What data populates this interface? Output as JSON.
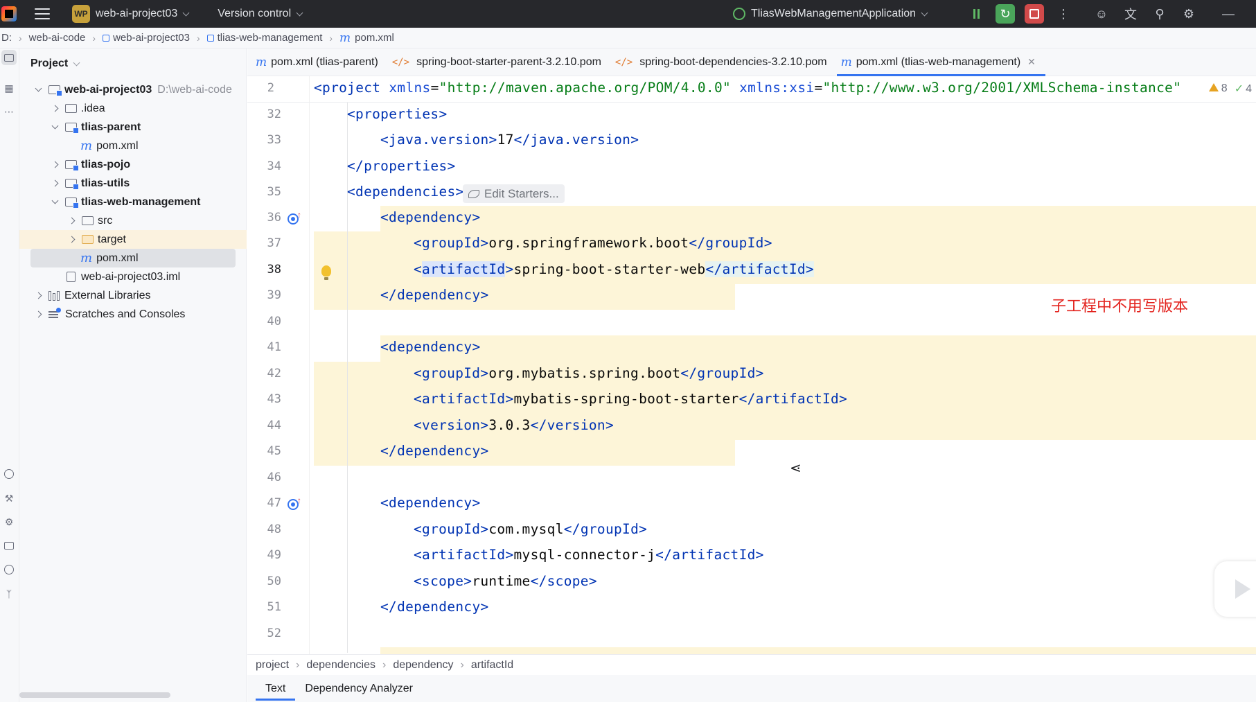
{
  "titlebar": {
    "project_badge": "WP",
    "project_name": "web-ai-project03",
    "vcs_label": "Version control",
    "run_config": "TliasWebManagementApplication"
  },
  "breadcrumb": {
    "drive": "D:",
    "items": [
      "web-ai-code",
      "web-ai-project03",
      "tlias-web-management",
      "pom.xml"
    ]
  },
  "project_panel": {
    "title": "Project",
    "root_name": "web-ai-project03",
    "root_path": "D:\\web-ai-code",
    "items": {
      "idea": ".idea",
      "tlias_parent": "tlias-parent",
      "tlias_parent_pom": "pom.xml",
      "tlias_pojo": "tlias-pojo",
      "tlias_utils": "tlias-utils",
      "tlias_web_management": "tlias-web-management",
      "src": "src",
      "target": "target",
      "pom": "pom.xml",
      "iml": "web-ai-project03.iml",
      "external_libraries": "External Libraries",
      "scratches": "Scratches and Consoles"
    }
  },
  "tabs": [
    {
      "label": "pom.xml (tlias-parent)",
      "icon": "maven-m-icon"
    },
    {
      "label": "spring-boot-starter-parent-3.2.10.pom",
      "icon": "xml-code-icon"
    },
    {
      "label": "spring-boot-dependencies-3.2.10.pom",
      "icon": "xml-code-icon"
    },
    {
      "label": "pom.xml (tlias-web-management)",
      "icon": "maven-m-icon",
      "active": true
    }
  ],
  "editor": {
    "sticky_line_number": "2",
    "sticky_line": {
      "open": "<project ",
      "a1": "xmlns",
      "eq1": "=",
      "v1": "\"http://maven.apache.org/POM/4.0.0\"",
      "a2": " xmlns:xsi",
      "eq2": "=",
      "v2": "\"http://www.w3.org/2001/XMLSchema-instance\""
    },
    "problems": {
      "warnings": "8",
      "ok": "4"
    },
    "line_numbers": [
      "32",
      "33",
      "34",
      "35",
      "36",
      "37",
      "38",
      "39",
      "40",
      "41",
      "42",
      "43",
      "44",
      "45",
      "46",
      "47",
      "48",
      "49",
      "50",
      "51",
      "52"
    ],
    "lines": {
      "l32": "<properties>",
      "l33_open": "<java.version>",
      "l33_val": "17",
      "l33_close": "</java.version>",
      "l34": "</properties>",
      "l35": "<dependencies>",
      "inlay_hint": "Edit Starters...",
      "l36": "<dependency>",
      "l37_open": "<groupId>",
      "l37_val": "org.springframework.boot",
      "l37_close": "</groupId>",
      "l38_lt": "<",
      "l38_tag": "artifactId",
      "l38_gt": ">",
      "l38_val": "spring-boot-starter-web",
      "l38_close": "</artifactId>",
      "l39": "</dependency>",
      "l41": "<dependency>",
      "l42_open": "<groupId>",
      "l42_val": "org.mybatis.spring.boot",
      "l42_close": "</groupId>",
      "l43_open": "<artifactId>",
      "l43_val": "mybatis-spring-boot-starter",
      "l43_close": "</artifactId>",
      "l44_open": "<version>",
      "l44_val": "3.0.3",
      "l44_close": "</version>",
      "l45": "</dependency>",
      "l47": "<dependency>",
      "l48_open": "<groupId>",
      "l48_val": "com.mysql",
      "l48_close": "</groupId>",
      "l49_open": "<artifactId>",
      "l49_val": "mysql-connector-j",
      "l49_close": "</artifactId>",
      "l50_open": "<scope>",
      "l50_val": "runtime",
      "l50_close": "</scope>",
      "l51": "</dependency>"
    },
    "annotation": "子工程中不用写版本"
  },
  "structure_path": [
    "project",
    "dependencies",
    "dependency",
    "artifactId"
  ],
  "bottom_tabs": [
    "Text",
    "Dependency Analyzer"
  ],
  "colors": {
    "accent": "#3574f0",
    "titlebar_bg": "#27282c",
    "xml_tag": "#0033b3",
    "changed_line_bg": "#fdf5d8",
    "annotation": "#e3231e"
  }
}
